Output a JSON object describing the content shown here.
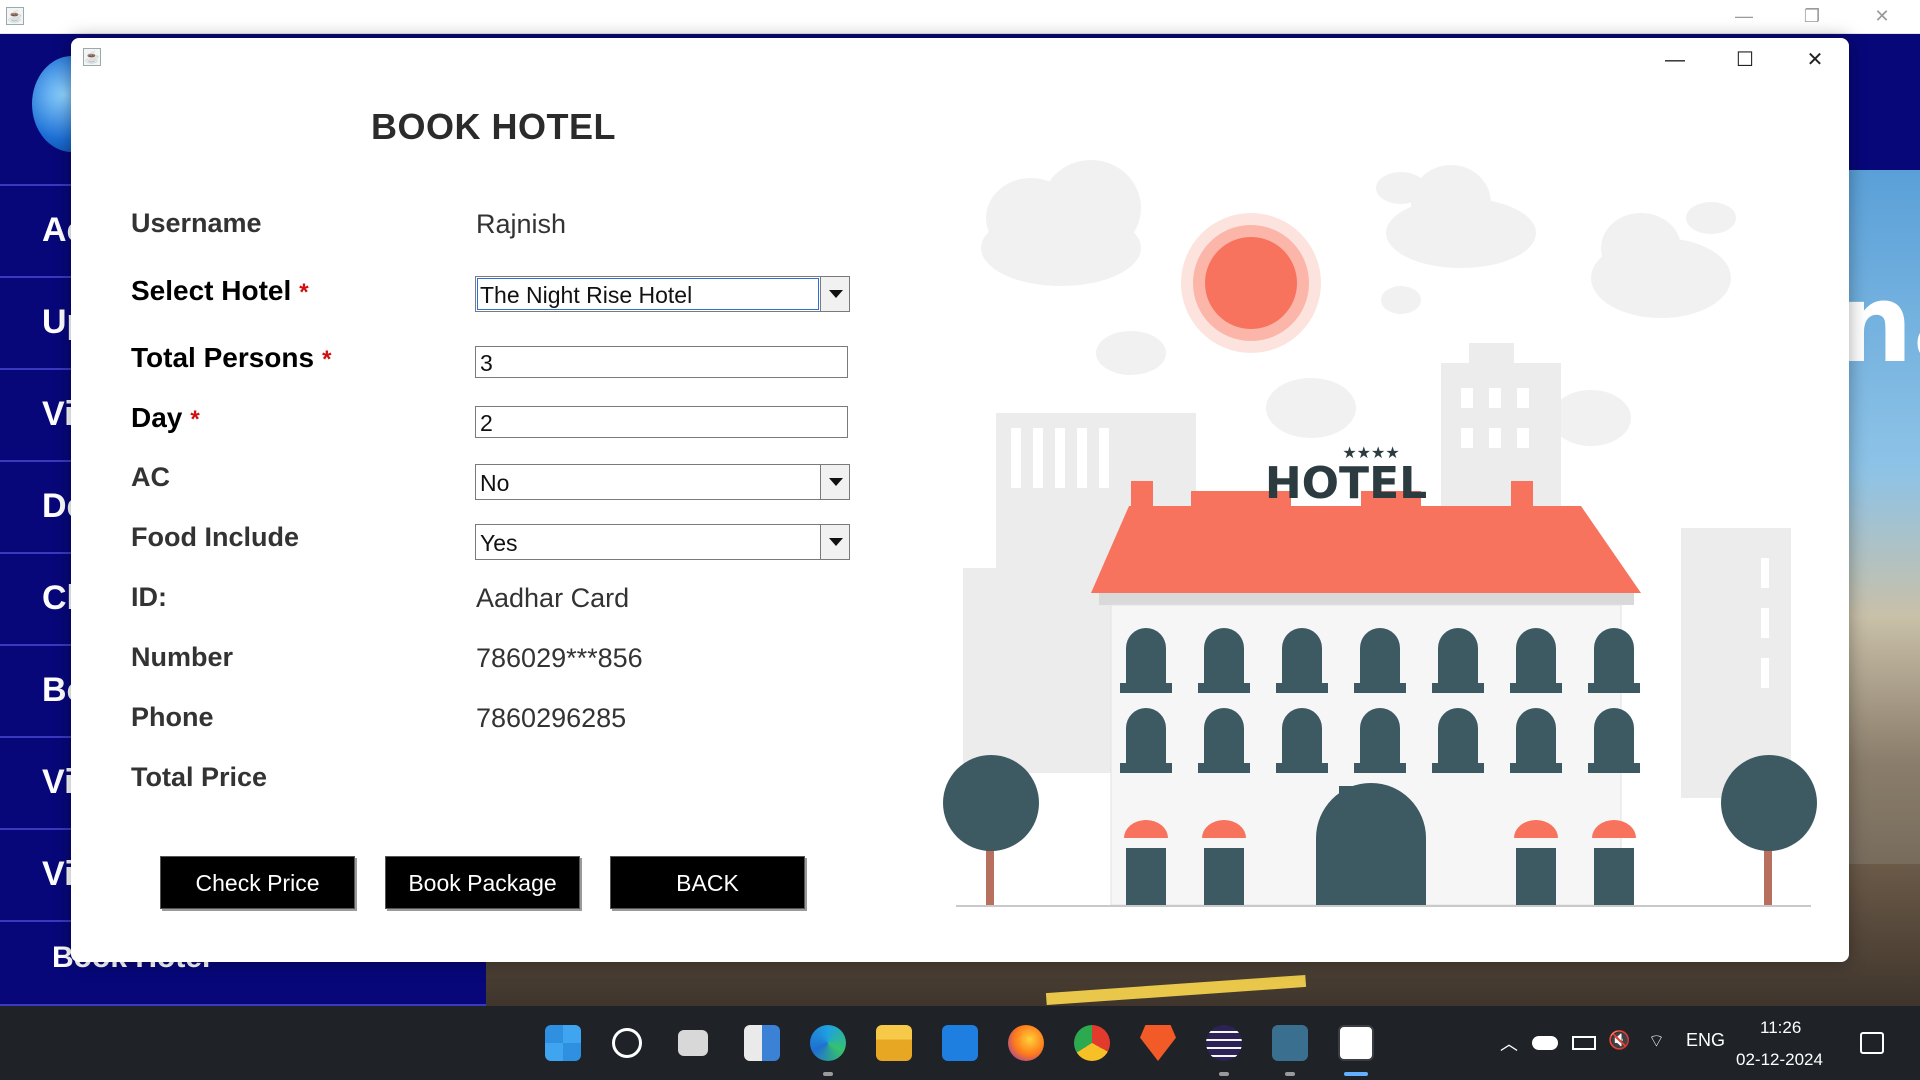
{
  "background_app": {
    "sidebar_items": [
      "Ac",
      "Up",
      "Vi",
      "De",
      "Ch",
      "Bo",
      "Vi",
      "Vi",
      "Book Hotel"
    ],
    "banner_text": "na"
  },
  "dialog": {
    "title": "BOOK HOTEL",
    "window_controls": {
      "minimize": "—",
      "maximize": "☐",
      "close": "✕"
    },
    "fields": {
      "username": {
        "label": "Username",
        "value": "Rajnish"
      },
      "select_hotel": {
        "label": "Select Hotel",
        "required": "*",
        "value": "The Night Rise Hotel"
      },
      "total_persons": {
        "label": "Total Persons",
        "required": "*",
        "value": "3"
      },
      "day": {
        "label": "Day",
        "required": "*",
        "value": "2"
      },
      "ac": {
        "label": "AC",
        "value": "No"
      },
      "food_include": {
        "label": "Food Include",
        "value": "Yes"
      },
      "id": {
        "label": "ID:",
        "value": "Aadhar Card"
      },
      "number": {
        "label": "Number",
        "value": "786029***856"
      },
      "phone": {
        "label": "Phone",
        "value": "7860296285"
      },
      "total_price": {
        "label": "Total Price",
        "value": ""
      }
    },
    "buttons": {
      "check_price": "Check Price",
      "book_package": "Book Package",
      "back": "BACK"
    },
    "illustration": {
      "sign": "HOTEL",
      "stars": "★★★★"
    }
  },
  "colors": {
    "sidebar": "#07077a",
    "button_bg": "#000000",
    "required": "#d01010",
    "roof": "#f7735e",
    "building_dark": "#3d5a63"
  },
  "taskbar": {
    "apps": [
      "windows-start-icon",
      "search-icon",
      "task-view-icon",
      "widgets-icon",
      "edge-icon",
      "file-explorer-icon",
      "mail-icon",
      "firefox-icon",
      "chrome-icon",
      "brave-icon",
      "eclipse-icon",
      "mysql-workbench-icon",
      "java-app-icon"
    ],
    "tray": {
      "language": "ENG",
      "time": "11:26",
      "date": "02-12-2024"
    }
  }
}
